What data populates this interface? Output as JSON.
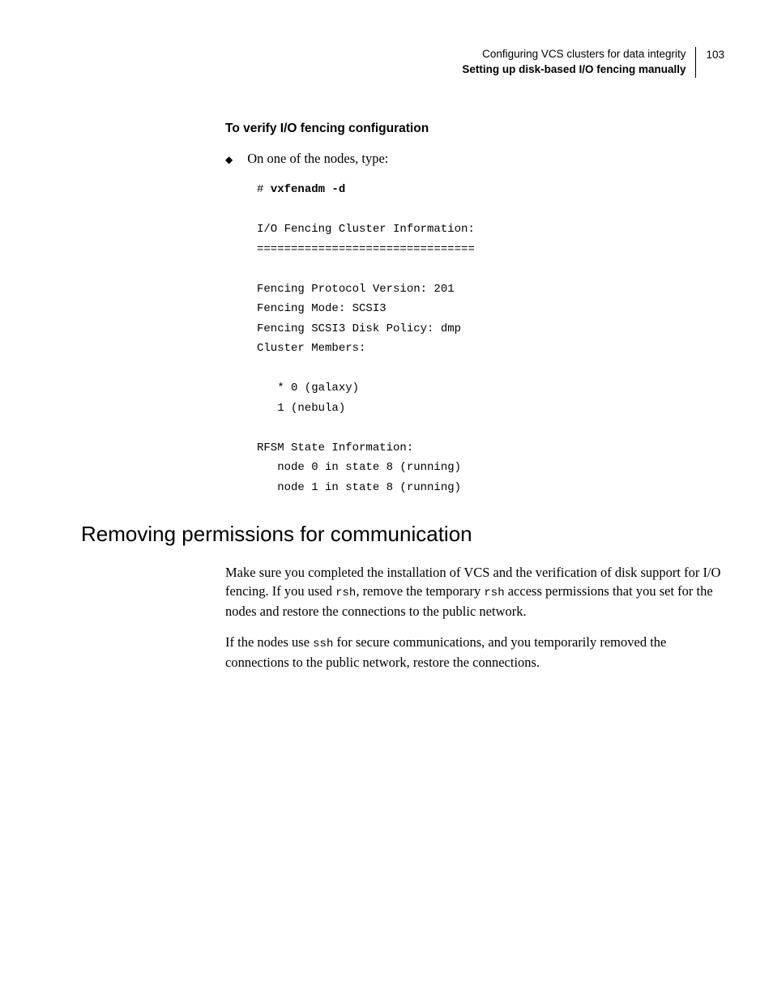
{
  "header": {
    "chapter": "Configuring VCS clusters for data integrity",
    "section": "Setting up disk-based I/O fencing manually",
    "page_number": "103"
  },
  "section1": {
    "title": "To verify I/O fencing configuration",
    "bullet_text": "On one of the nodes, type:",
    "code_prompt": "# ",
    "code_cmd": "vxfenadm -d",
    "code_output": "\n\nI/O Fencing Cluster Information:\n================================\n\nFencing Protocol Version: 201\nFencing Mode: SCSI3\nFencing SCSI3 Disk Policy: dmp\nCluster Members:\n\n   * 0 (galaxy)\n   1 (nebula)\n\nRFSM State Information:\n   node 0 in state 8 (running)\n   node 1 in state 8 (running)"
  },
  "section2": {
    "title": "Removing permissions for communication",
    "para1_part1": "Make sure you completed the installation of VCS and the verification of disk support for I/O fencing. If you used ",
    "para1_code1": "rsh",
    "para1_part2": ", remove the temporary ",
    "para1_code2": "rsh",
    "para1_part3": " access permissions that you set for the nodes and restore the connections to the public network.",
    "para2_part1": "If the nodes use ",
    "para2_code1": "ssh",
    "para2_part2": " for secure communications, and you temporarily removed the connections to the public network, restore the connections."
  }
}
